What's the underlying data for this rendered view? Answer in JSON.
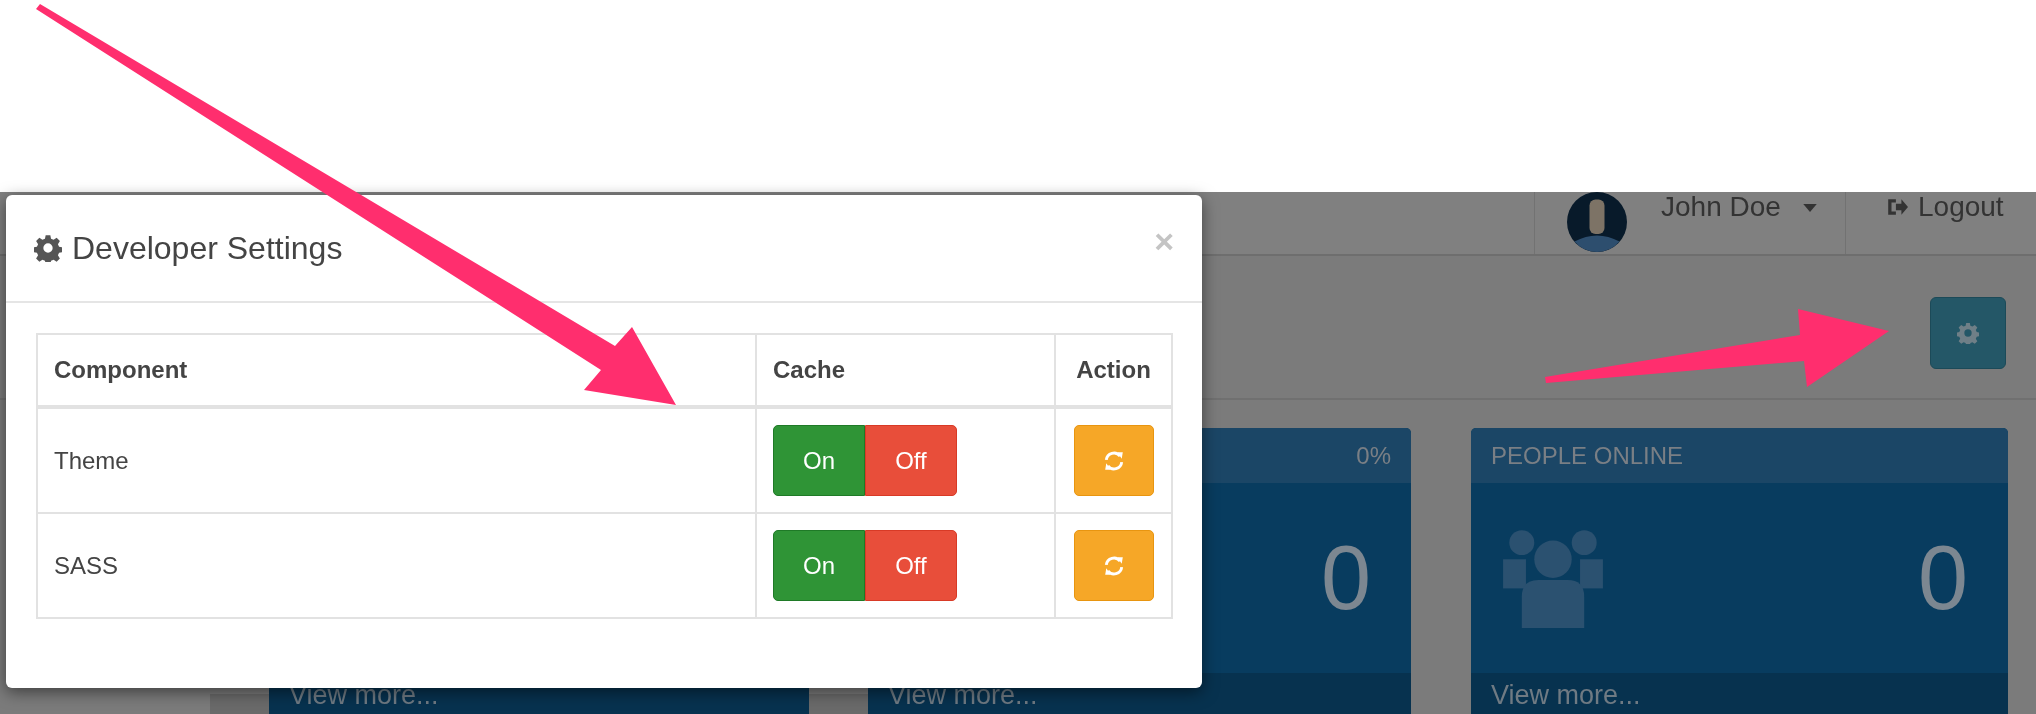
{
  "header": {
    "user_name": "John Doe",
    "logout": "Logout"
  },
  "cards": [
    {
      "footer": "View more..."
    },
    {
      "percent": "0%",
      "value": "0",
      "footer": "View more..."
    },
    {
      "title": "PEOPLE ONLINE",
      "value": "0",
      "footer": "View more..."
    }
  ],
  "modal": {
    "title": "Developer Settings",
    "close": "×",
    "columns": [
      "Component",
      "Cache",
      "Action"
    ],
    "rows": [
      {
        "component": "Theme",
        "on": "On",
        "off": "Off"
      },
      {
        "component": "SASS",
        "on": "On",
        "off": "Off"
      }
    ]
  }
}
